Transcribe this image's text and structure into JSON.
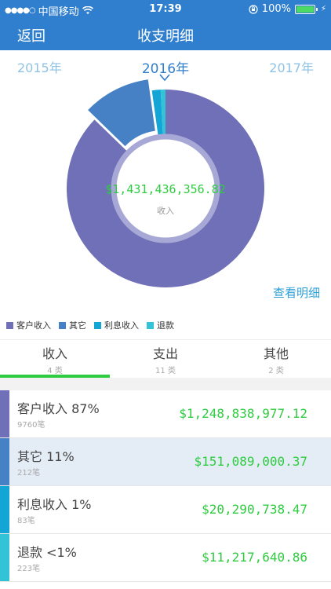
{
  "status_bar": {
    "signal_dots": "●●●●○",
    "carrier": "中国移动",
    "wifi_icon": "wifi-icon",
    "time": "17:39",
    "lock_icon": "orientation-lock-icon",
    "battery": "100%",
    "bolt": "⚡"
  },
  "nav": {
    "back_label": "返回",
    "title": "收支明细"
  },
  "years": {
    "prev": "2015年",
    "current": "2016年",
    "next": "2017年"
  },
  "chart_data": {
    "type": "pie",
    "total_label": "$1,431,436,356.82",
    "center_label": "收入",
    "slices": [
      {
        "name": "客户收入",
        "value": 1248838977.12,
        "color": "#6f70b7"
      },
      {
        "name": "其它",
        "value": 151089000.37,
        "color": "#4680c5"
      },
      {
        "name": "利息收入",
        "value": 20290738.47,
        "color": "#12a5d6"
      },
      {
        "name": "退款",
        "value": 11217640.86,
        "color": "#33c3d6"
      }
    ]
  },
  "detail_link": "查看明细",
  "tabs": [
    {
      "label": "收入",
      "count": "4 类"
    },
    {
      "label": "支出",
      "count": "11 类"
    },
    {
      "label": "其他",
      "count": "2 类"
    }
  ],
  "rows": [
    {
      "title": "客户收入 87%",
      "count": "9760笔",
      "amount": "$1,248,838,977.12",
      "color": "#6f70b7"
    },
    {
      "title": "其它 11%",
      "count": "212笔",
      "amount": "$151,089,000.37",
      "color": "#4680c5"
    },
    {
      "title": "利息收入 1%",
      "count": "83笔",
      "amount": "$20,290,738.47",
      "color": "#12a5d6"
    },
    {
      "title": "退款 <1%",
      "count": "223笔",
      "amount": "$11,217,640.86",
      "color": "#33c3d6"
    }
  ]
}
